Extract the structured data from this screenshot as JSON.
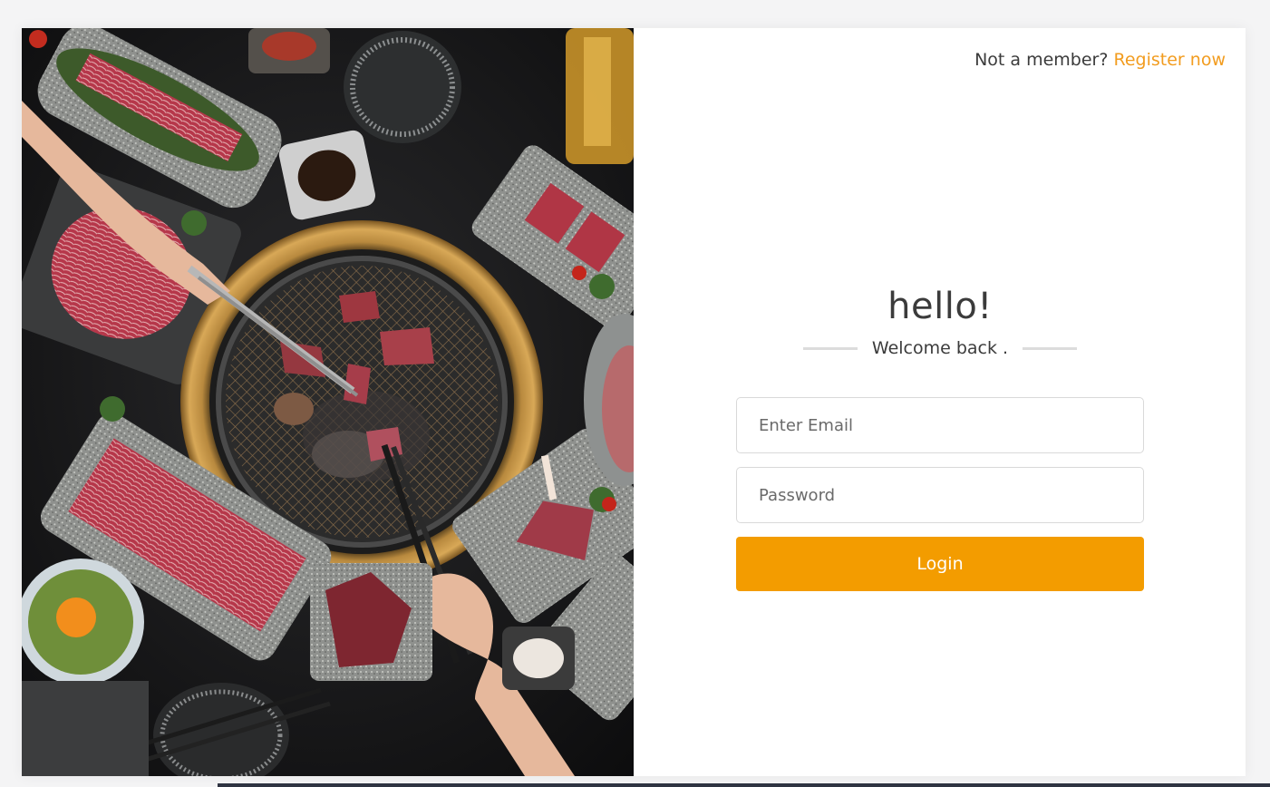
{
  "header": {
    "prompt_text": "Not a member?",
    "register_label": "Register now"
  },
  "hero": {
    "icon": "bbq-grill-photo"
  },
  "form": {
    "greeting": "hello!",
    "welcome": "Welcome back .",
    "email_placeholder": "Enter Email",
    "password_placeholder": "Password",
    "login_label": "Login"
  },
  "colors": {
    "accent": "#f39c00",
    "link": "#f29c1f",
    "text": "#3b3b3b"
  }
}
